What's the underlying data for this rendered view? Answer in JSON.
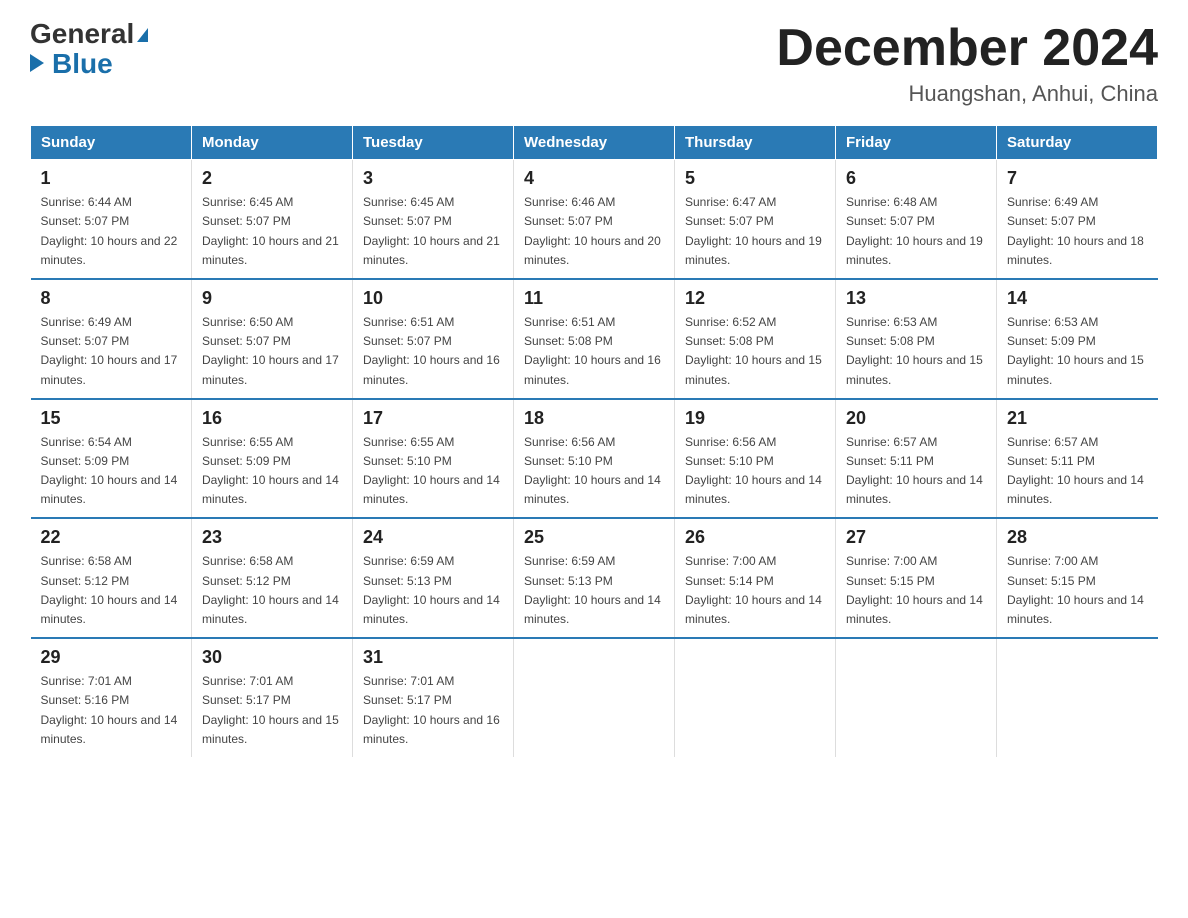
{
  "header": {
    "logo_general": "General",
    "logo_blue": "Blue",
    "title": "December 2024",
    "location": "Huangshan, Anhui, China"
  },
  "days_of_week": [
    "Sunday",
    "Monday",
    "Tuesday",
    "Wednesday",
    "Thursday",
    "Friday",
    "Saturday"
  ],
  "weeks": [
    [
      {
        "day": 1,
        "sunrise": "6:44 AM",
        "sunset": "5:07 PM",
        "daylight": "10 hours and 22 minutes."
      },
      {
        "day": 2,
        "sunrise": "6:45 AM",
        "sunset": "5:07 PM",
        "daylight": "10 hours and 21 minutes."
      },
      {
        "day": 3,
        "sunrise": "6:45 AM",
        "sunset": "5:07 PM",
        "daylight": "10 hours and 21 minutes."
      },
      {
        "day": 4,
        "sunrise": "6:46 AM",
        "sunset": "5:07 PM",
        "daylight": "10 hours and 20 minutes."
      },
      {
        "day": 5,
        "sunrise": "6:47 AM",
        "sunset": "5:07 PM",
        "daylight": "10 hours and 19 minutes."
      },
      {
        "day": 6,
        "sunrise": "6:48 AM",
        "sunset": "5:07 PM",
        "daylight": "10 hours and 19 minutes."
      },
      {
        "day": 7,
        "sunrise": "6:49 AM",
        "sunset": "5:07 PM",
        "daylight": "10 hours and 18 minutes."
      }
    ],
    [
      {
        "day": 8,
        "sunrise": "6:49 AM",
        "sunset": "5:07 PM",
        "daylight": "10 hours and 17 minutes."
      },
      {
        "day": 9,
        "sunrise": "6:50 AM",
        "sunset": "5:07 PM",
        "daylight": "10 hours and 17 minutes."
      },
      {
        "day": 10,
        "sunrise": "6:51 AM",
        "sunset": "5:07 PM",
        "daylight": "10 hours and 16 minutes."
      },
      {
        "day": 11,
        "sunrise": "6:51 AM",
        "sunset": "5:08 PM",
        "daylight": "10 hours and 16 minutes."
      },
      {
        "day": 12,
        "sunrise": "6:52 AM",
        "sunset": "5:08 PM",
        "daylight": "10 hours and 15 minutes."
      },
      {
        "day": 13,
        "sunrise": "6:53 AM",
        "sunset": "5:08 PM",
        "daylight": "10 hours and 15 minutes."
      },
      {
        "day": 14,
        "sunrise": "6:53 AM",
        "sunset": "5:09 PM",
        "daylight": "10 hours and 15 minutes."
      }
    ],
    [
      {
        "day": 15,
        "sunrise": "6:54 AM",
        "sunset": "5:09 PM",
        "daylight": "10 hours and 14 minutes."
      },
      {
        "day": 16,
        "sunrise": "6:55 AM",
        "sunset": "5:09 PM",
        "daylight": "10 hours and 14 minutes."
      },
      {
        "day": 17,
        "sunrise": "6:55 AM",
        "sunset": "5:10 PM",
        "daylight": "10 hours and 14 minutes."
      },
      {
        "day": 18,
        "sunrise": "6:56 AM",
        "sunset": "5:10 PM",
        "daylight": "10 hours and 14 minutes."
      },
      {
        "day": 19,
        "sunrise": "6:56 AM",
        "sunset": "5:10 PM",
        "daylight": "10 hours and 14 minutes."
      },
      {
        "day": 20,
        "sunrise": "6:57 AM",
        "sunset": "5:11 PM",
        "daylight": "10 hours and 14 minutes."
      },
      {
        "day": 21,
        "sunrise": "6:57 AM",
        "sunset": "5:11 PM",
        "daylight": "10 hours and 14 minutes."
      }
    ],
    [
      {
        "day": 22,
        "sunrise": "6:58 AM",
        "sunset": "5:12 PM",
        "daylight": "10 hours and 14 minutes."
      },
      {
        "day": 23,
        "sunrise": "6:58 AM",
        "sunset": "5:12 PM",
        "daylight": "10 hours and 14 minutes."
      },
      {
        "day": 24,
        "sunrise": "6:59 AM",
        "sunset": "5:13 PM",
        "daylight": "10 hours and 14 minutes."
      },
      {
        "day": 25,
        "sunrise": "6:59 AM",
        "sunset": "5:13 PM",
        "daylight": "10 hours and 14 minutes."
      },
      {
        "day": 26,
        "sunrise": "7:00 AM",
        "sunset": "5:14 PM",
        "daylight": "10 hours and 14 minutes."
      },
      {
        "day": 27,
        "sunrise": "7:00 AM",
        "sunset": "5:15 PM",
        "daylight": "10 hours and 14 minutes."
      },
      {
        "day": 28,
        "sunrise": "7:00 AM",
        "sunset": "5:15 PM",
        "daylight": "10 hours and 14 minutes."
      }
    ],
    [
      {
        "day": 29,
        "sunrise": "7:01 AM",
        "sunset": "5:16 PM",
        "daylight": "10 hours and 14 minutes."
      },
      {
        "day": 30,
        "sunrise": "7:01 AM",
        "sunset": "5:17 PM",
        "daylight": "10 hours and 15 minutes."
      },
      {
        "day": 31,
        "sunrise": "7:01 AM",
        "sunset": "5:17 PM",
        "daylight": "10 hours and 16 minutes."
      },
      null,
      null,
      null,
      null
    ]
  ]
}
